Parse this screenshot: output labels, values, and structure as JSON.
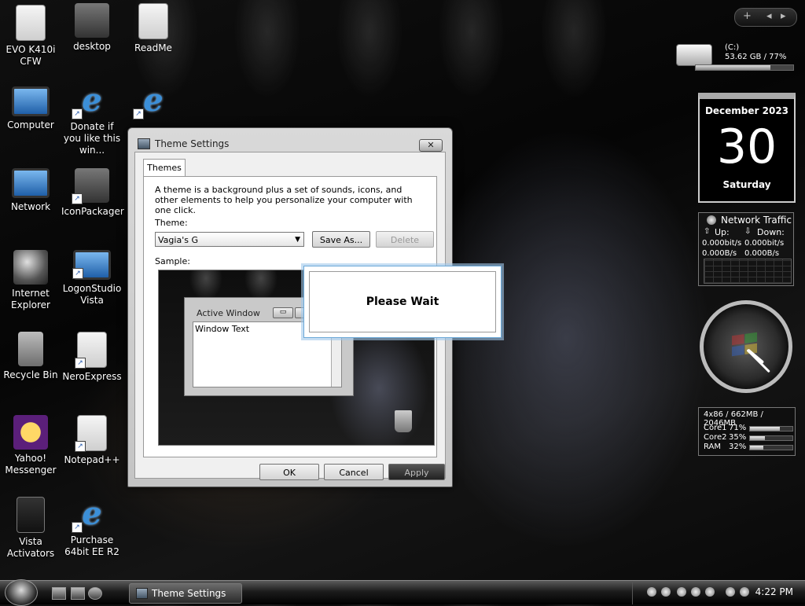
{
  "desktop_icons": [
    {
      "label": "EVO K410i CFW",
      "icon": "document-icon"
    },
    {
      "label": "desktop",
      "icon": "ini-file-icon"
    },
    {
      "label": "ReadMe",
      "icon": "text-file-icon"
    },
    {
      "label": "Computer",
      "icon": "computer-icon"
    },
    {
      "label": "Donate if you like this win...",
      "icon": "internet-explorer-icon"
    },
    {
      "label": "",
      "icon": "internet-explorer-icon"
    },
    {
      "label": "Network",
      "icon": "network-icon"
    },
    {
      "label": "IconPackager",
      "icon": "iconpackager-icon"
    },
    {
      "label": "Internet Explorer",
      "icon": "internet-explorer-icon"
    },
    {
      "label": "LogonStudio Vista",
      "icon": "logonstudio-icon"
    },
    {
      "label": "Recycle Bin",
      "icon": "recycle-bin-icon"
    },
    {
      "label": "NeroExpress",
      "icon": "neroexpress-icon"
    },
    {
      "label": "Yahoo! Messenger",
      "icon": "yahoo-messenger-icon"
    },
    {
      "label": "Notepad++",
      "icon": "notepad-icon"
    },
    {
      "label": "Vista Activators",
      "icon": "folder-icon"
    },
    {
      "label": "Purchase 64bit EE R2",
      "icon": "internet-explorer-icon"
    }
  ],
  "theme_window": {
    "title": "Theme Settings",
    "close_label": "✕",
    "tab": "Themes",
    "description": "A theme is a background plus a set of sounds, icons, and other elements to help you personalize your computer with one click.",
    "theme_label": "Theme:",
    "theme_value": "Vagia's G",
    "save_as": "Save As...",
    "delete": "Delete",
    "sample_label": "Sample:",
    "sample": {
      "active_window": "Active Window",
      "window_text": "Window Text",
      "minimize": "▭"
    },
    "ok": "OK",
    "cancel": "Cancel",
    "apply": "Apply"
  },
  "please_wait": "Please Wait",
  "gadgets": {
    "toolbar": {
      "add": "+",
      "prev": "◂",
      "next": "▸"
    },
    "drive": {
      "name": "(C:)",
      "usage": "53.62 GB / 77%",
      "used_fraction": 0.77
    },
    "calendar": {
      "month": "December 2023",
      "day": "30",
      "weekday": "Saturday"
    },
    "network": {
      "title": "Network Traffic",
      "up_label": "Up:",
      "down_label": "Down:",
      "up_bits": "0.000bit/s",
      "down_bits": "0.000bit/s",
      "up_bytes": "0.000B/s",
      "down_bytes": "0.000B/s"
    },
    "cpu": {
      "header": "4x86 / 662MB / 2046MB",
      "rows": [
        {
          "name": "Core1",
          "value": "71%",
          "fraction": 0.71
        },
        {
          "name": "Core2",
          "value": "35%",
          "fraction": 0.35
        },
        {
          "name": "RAM",
          "value": "32%",
          "fraction": 0.32
        }
      ]
    }
  },
  "taskbar": {
    "task": "Theme Settings",
    "time": "4:22 PM"
  }
}
